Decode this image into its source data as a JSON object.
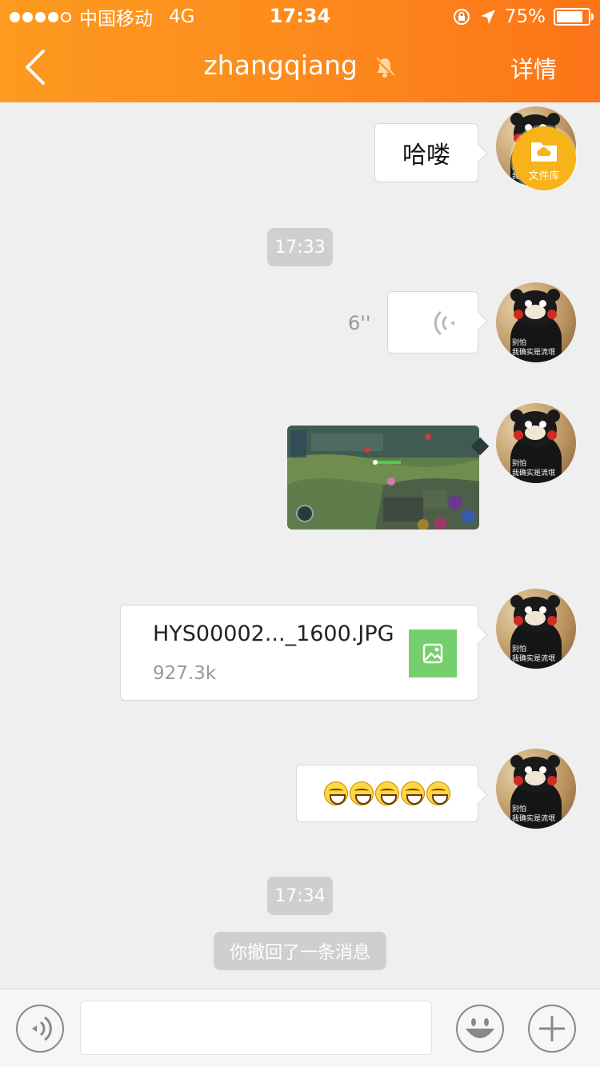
{
  "status_bar": {
    "carrier": "中国移动",
    "network": "4G",
    "time": "17:34",
    "battery": "75%",
    "battery_level": 0.75,
    "icons": [
      "signal-dots-icon",
      "orientation-lock-icon",
      "location-arrow-icon",
      "battery-icon"
    ]
  },
  "header": {
    "title": "zhangqiang",
    "details_label": "详情",
    "icons": [
      "back-chevron-icon",
      "muted-bell-icon"
    ]
  },
  "avatar": {
    "caption_line1": "别怕",
    "caption_line2": "我确实是流氓"
  },
  "floating_button": {
    "label": "文件库",
    "icon": "folder-cloud-icon"
  },
  "messages": [
    {
      "type": "text",
      "text": "哈喽"
    },
    {
      "type": "time",
      "text": "17:33"
    },
    {
      "type": "voice",
      "duration": "6''",
      "icon": "voice-wave-icon"
    },
    {
      "type": "image",
      "description": "game screenshot"
    },
    {
      "type": "file",
      "name": "HYS00002..._1600.JPG",
      "size": "927.3k",
      "icon": "image-file-icon"
    },
    {
      "type": "emoji",
      "count": 5,
      "icon": "grinning-emoji-icon"
    },
    {
      "type": "time",
      "text": "17:34"
    },
    {
      "type": "system",
      "text": "你撤回了一条消息"
    }
  ],
  "input_bar": {
    "input_value": "",
    "icons": [
      "voice-input-icon",
      "emoji-icon",
      "plus-icon"
    ]
  },
  "colors": {
    "header_gradient_start": "#fd9a1f",
    "header_gradient_end": "#fc7418",
    "background": "#efefef",
    "time_pill": "#cfcfcf",
    "file_thumb": "#74cf6c",
    "fab": "#f7b317"
  }
}
